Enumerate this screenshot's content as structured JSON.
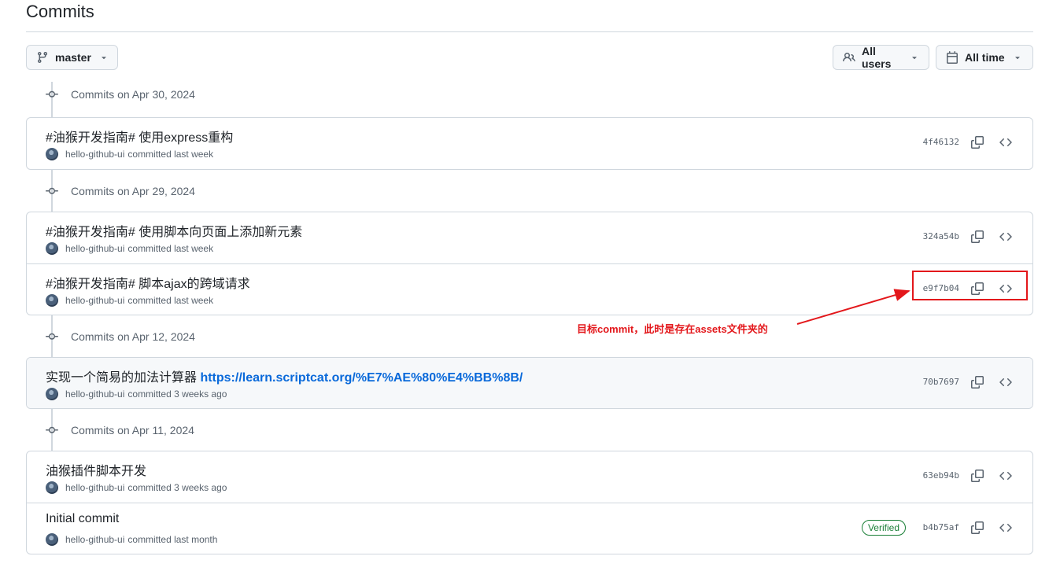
{
  "page": {
    "title": "Commits"
  },
  "filters": {
    "branch": "master",
    "users": "All users",
    "time": "All time"
  },
  "groups": [
    {
      "date_label": "Commits on Apr 30, 2024",
      "commits": [
        {
          "message": "#油猴开发指南# 使用express重构",
          "link": "",
          "author": "hello-github-ui",
          "when": "committed last week",
          "sha": "4f46132",
          "verified": ""
        }
      ]
    },
    {
      "date_label": "Commits on Apr 29, 2024",
      "commits": [
        {
          "message": "#油猴开发指南# 使用脚本向页面上添加新元素",
          "link": "",
          "author": "hello-github-ui",
          "when": "committed last week",
          "sha": "324a54b",
          "verified": ""
        },
        {
          "message": "#油猴开发指南# 脚本ajax的跨域请求",
          "link": "",
          "author": "hello-github-ui",
          "when": "committed last week",
          "sha": "e9f7b04",
          "verified": ""
        }
      ]
    },
    {
      "date_label": "Commits on Apr 12, 2024",
      "commits": [
        {
          "message": "实现一个简易的加法计算器 ",
          "link": "https://learn.scriptcat.org/%E7%AE%80%E4%BB%8B/",
          "author": "hello-github-ui",
          "when": "committed 3 weeks ago",
          "sha": "70b7697",
          "verified": ""
        }
      ]
    },
    {
      "date_label": "Commits on Apr 11, 2024",
      "commits": [
        {
          "message": "油猴插件脚本开发",
          "link": "",
          "author": "hello-github-ui",
          "when": "committed 3 weeks ago",
          "sha": "63eb94b",
          "verified": ""
        },
        {
          "message": "Initial commit",
          "link": "",
          "author": "hello-github-ui",
          "when": "committed last month",
          "sha": "b4b75af",
          "verified": "Verified"
        }
      ]
    }
  ],
  "annotation": {
    "text": "目标commit，此时是存在assets文件夹的",
    "color": "#e3171b"
  },
  "colors": {
    "border": "#d0d7de",
    "muted": "#59636e",
    "link": "#0969da",
    "verified": "#1a7f37",
    "highlight_row": "#f6f8fa"
  },
  "icons": {
    "branch": "git-branch-icon",
    "users": "people-icon",
    "time": "calendar-icon",
    "commit": "git-commit-icon",
    "copy": "copy-icon",
    "browse": "code-icon",
    "dropdown": "triangle-down-icon"
  }
}
